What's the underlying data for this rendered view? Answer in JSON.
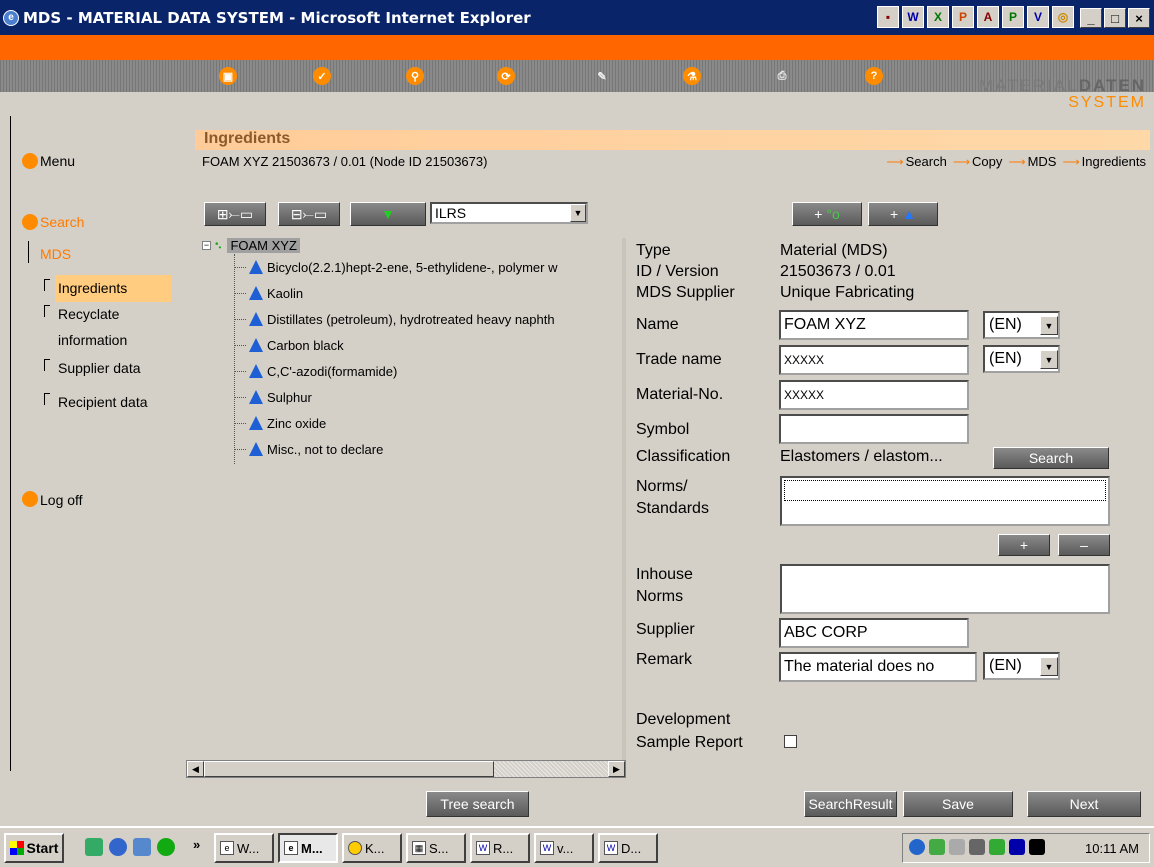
{
  "window": {
    "title": "MDS - MATERIAL DATA SYSTEM - Microsoft Internet Explorer",
    "controls": [
      "_",
      "□",
      "×"
    ]
  },
  "logo": {
    "part1": "MATERIAL",
    "part2": "DATEN",
    "part3": "SYSTEM"
  },
  "sidebar": {
    "menu": "Menu",
    "search": "Search",
    "mds": "MDS",
    "items": [
      {
        "label": "Ingredients"
      },
      {
        "label": "Recyclate"
      },
      {
        "label": "information"
      },
      {
        "label": "Supplier data"
      },
      {
        "label": "Recipient data"
      }
    ],
    "logoff": "Log off"
  },
  "header": {
    "title": "Ingredients",
    "node_line": "FOAM XYZ 21503673 / 0.01 (Node ID 21503673)",
    "breadcrumbs": [
      "Search",
      "Copy",
      "MDS",
      "Ingredients"
    ]
  },
  "tree_toolbar": {
    "filter_value": "ILRS"
  },
  "tree": {
    "root": "FOAM XYZ",
    "items": [
      "Bicyclo(2.2.1)hept-2-ene, 5-ethylidene-, polymer w",
      "Kaolin",
      "Distillates (petroleum), hydrotreated heavy naphth",
      "Carbon black",
      "C,C'-azodi(formamide)",
      "Sulphur",
      "Zinc oxide",
      "Misc., not to declare"
    ]
  },
  "props": {
    "type_label": "Type",
    "type_value": "Material (MDS)",
    "id_label": "ID / Version",
    "id_value": "21503673 / 0.01",
    "supplier_mds_label": "MDS Supplier",
    "supplier_mds_value": "Unique Fabricating",
    "name_label": "Name",
    "name_value": "FOAM XYZ",
    "name_lang": "(EN)",
    "trade_label": "Trade name",
    "trade_value": "XXXXX",
    "trade_lang": "(EN)",
    "matno_label": "Material-No.",
    "matno_value": "XXXXX",
    "symbol_label": "Symbol",
    "symbol_value": "",
    "class_label": "Classification",
    "class_value": "Elastomers / elastom...",
    "class_search": "Search",
    "norms_label1": "Norms/",
    "norms_label2": "Standards",
    "plus": "+",
    "minus": "–",
    "inhouse_label1": "Inhouse",
    "inhouse_label2": "Norms",
    "supplier_label": "Supplier",
    "supplier_value": "ABC CORP",
    "remark_label": "Remark",
    "remark_value": "The material does no",
    "remark_lang": "(EN)",
    "dev_label1": "Development",
    "dev_label2": "Sample Report"
  },
  "buttons": {
    "tree_search": "Tree search",
    "search_result": "SearchResult",
    "save": "Save",
    "next": "Next"
  },
  "taskbar": {
    "start": "Start",
    "tasks": [
      "W...",
      "M...",
      "K...",
      "S...",
      "R...",
      "v...",
      "D..."
    ],
    "clock": "10:11 AM"
  }
}
